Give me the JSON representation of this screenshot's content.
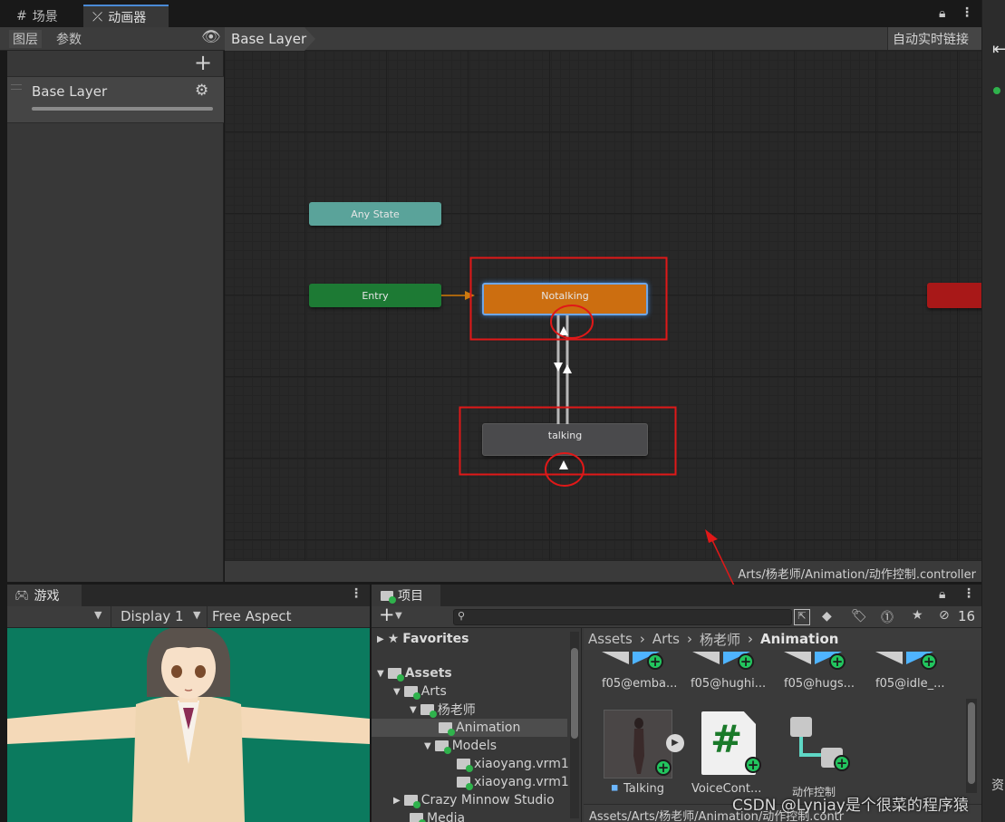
{
  "tabs": {
    "scene": "场景",
    "animator": "动画器"
  },
  "animator": {
    "subtabs": [
      "图层",
      "参数"
    ],
    "breadcrumb": "Base Layer",
    "auto_live_link": "自动实时链接",
    "layer_name": "Base Layer",
    "controller_path": "Arts/杨老师/Animation/动作控制.controller"
  },
  "graph": {
    "nodes": {
      "any_state": "Any State",
      "entry": "Entry",
      "notalking": "Notalking",
      "talking": "talking"
    }
  },
  "colors": {
    "any_state": "#5aa39a",
    "entry": "#1d7a34",
    "default_state": "#cc6e10",
    "state": "#4a4a4c",
    "exit": "#a81818",
    "annotation": "#e01818"
  },
  "game": {
    "tab": "游戏",
    "display": "Display 1",
    "aspect": "Free Aspect"
  },
  "project": {
    "tab": "项目",
    "hidden_count": "16",
    "favorites": "Favorites",
    "tree": [
      "Assets",
      "Arts",
      "杨老师",
      "Animation",
      "Models",
      "xiaoyang.vrm1",
      "xiaoyang.vrm1",
      "Crazy Minnow Studio",
      "Media"
    ],
    "breadcrumb": [
      "Assets",
      "Arts",
      "杨老师",
      "Animation"
    ],
    "assets_row1": [
      "f05@emba...",
      "f05@hughi...",
      "f05@hugs...",
      "f05@idle_..."
    ],
    "assets_row2": [
      "Talking",
      "VoiceCont...",
      "动作控制"
    ],
    "status_path": "Assets/Arts/杨老师/Animation/动作控制.contr"
  },
  "watermark": "CSDN @Lynjay是个很菜的程序猿",
  "right_sidebar_char": "资"
}
